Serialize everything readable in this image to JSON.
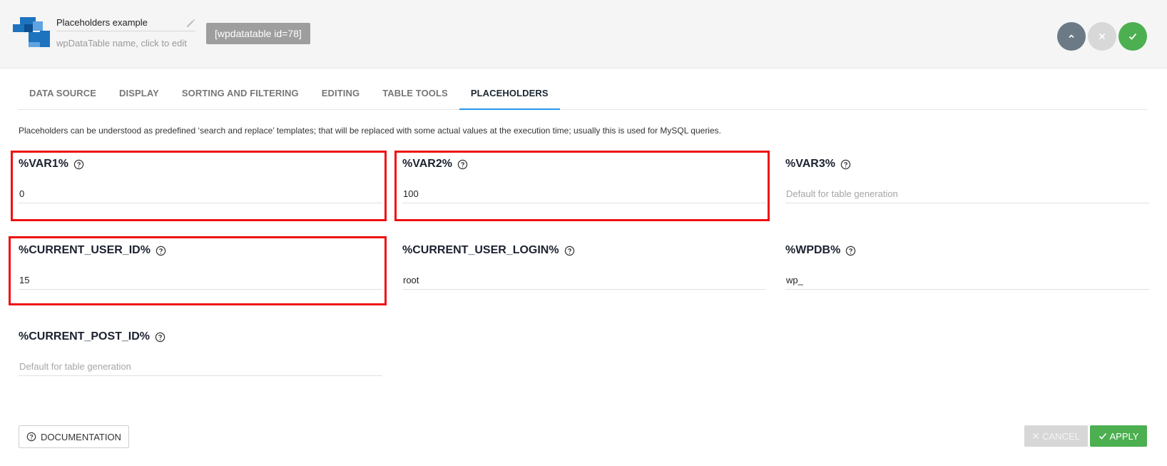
{
  "header": {
    "table_name": "Placeholders example",
    "table_name_hint": "wpDataTable name, click to edit",
    "shortcode": "[wpdatatable id=78]"
  },
  "tabs": [
    {
      "label": "DATA SOURCE"
    },
    {
      "label": "DISPLAY"
    },
    {
      "label": "SORTING AND FILTERING"
    },
    {
      "label": "EDITING"
    },
    {
      "label": "TABLE TOOLS"
    },
    {
      "label": "PLACEHOLDERS",
      "active": true
    }
  ],
  "description": "Placeholders can be understood as predefined ‘search and replace’ templates; that will be replaced with some actual values at the execution time; usually this is used for MySQL queries.",
  "placeholders": {
    "var1": {
      "label": "%VAR1%",
      "value": "0",
      "placeholder": "Default for table generation"
    },
    "var2": {
      "label": "%VAR2%",
      "value": "100",
      "placeholder": "Default for table generation"
    },
    "var3": {
      "label": "%VAR3%",
      "value": "",
      "placeholder": "Default for table generation"
    },
    "current_user_id": {
      "label": "%CURRENT_USER_ID%",
      "value": "15",
      "placeholder": "Default for table generation"
    },
    "current_user_login": {
      "label": "%CURRENT_USER_LOGIN%",
      "value": "root",
      "placeholder": "Default for table generation"
    },
    "wpdb": {
      "label": "%WPDB%",
      "value": "wp_",
      "placeholder": "Default for table generation"
    },
    "current_post_id": {
      "label": "%CURRENT_POST_ID%",
      "value": "",
      "placeholder": "Default for table generation"
    }
  },
  "footer": {
    "documentation_label": "DOCUMENTATION",
    "cancel_label": "CANCEL",
    "apply_label": "APPLY"
  },
  "colors": {
    "accent": "#2196f3",
    "apply": "#4caf50",
    "highlight": "#ee1111",
    "logo_blue": "#1e73be"
  }
}
